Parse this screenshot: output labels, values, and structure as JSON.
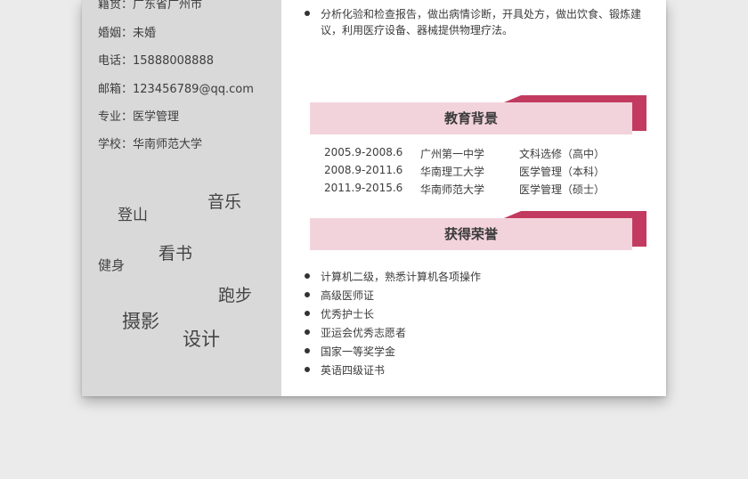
{
  "personal": [
    {
      "key": "籍贯：",
      "value": "广东省广州市"
    },
    {
      "key": "婚姻：",
      "value": "未婚"
    },
    {
      "key": "电话：",
      "value": "15888008888"
    },
    {
      "key": "邮箱：",
      "value": "123456789@qq.com"
    },
    {
      "key": "专业：",
      "value": "医学管理"
    },
    {
      "key": "学校：",
      "value": "华南师范大学"
    }
  ],
  "hobbies": [
    "登山",
    "音乐",
    "看书",
    "健身",
    "跑步",
    "摄影",
    "设计"
  ],
  "work_lines": [
    "分析化验和检查报告，做出病情诊断，开具处方，做出饮食、锻炼建",
    "议，利用医疗设备、器械提供物理疗法。"
  ],
  "education": {
    "title": "教育背景",
    "rows": [
      {
        "period": "2005.9-2008.6",
        "school": "广州第一中学",
        "major": "文科选修（高中）"
      },
      {
        "period": "2008.9-2011.6",
        "school": "华南理工大学",
        "major": "医学管理（本科）"
      },
      {
        "period": "2011.9-2015.6",
        "school": "华南师范大学",
        "major": "医学管理（硕士）"
      }
    ]
  },
  "honors": {
    "title": "获得荣誉",
    "items": [
      "计算机二级，熟悉计算机各项操作",
      "高级医师证",
      "优秀护士长",
      "亚运会优秀志愿者",
      "国家一等奖学金",
      "英语四级证书"
    ]
  },
  "colors": {
    "accent": "#c23a5f",
    "band": "#f2d3dc",
    "sidebar": "#d9d9d9"
  }
}
